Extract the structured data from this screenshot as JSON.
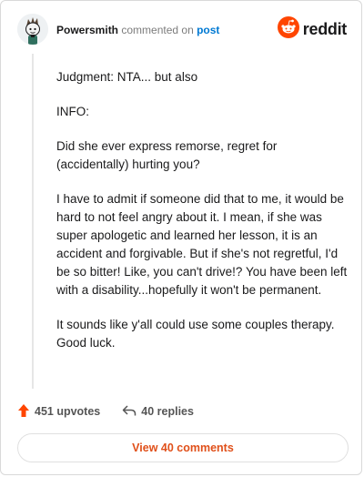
{
  "header": {
    "username": "Powersmith",
    "commented_text": "commented on",
    "post_link": "post",
    "brand": "reddit",
    "brand_color": "#ff4500"
  },
  "comment": {
    "paragraphs": [
      "Judgment: NTA... but also",
      "INFO:",
      "Did she ever express remorse, regret for (accidentally) hurting you?",
      "I have to admit if someone did that to me, it would be hard to not feel angry about it. I mean, if she was super apologetic and learned her lesson, it is an accident and forgivable. But if she's not regretful, I'd be so bitter! Like, you can't drive!? You have been left with a disability...hopefully it won't be permanent.",
      "It sounds like y'all could use some couples therapy. Good luck."
    ]
  },
  "actions": {
    "upvotes": "451 upvotes",
    "replies": "40 replies",
    "upvote_icon": "arrow-up-icon",
    "reply_icon": "reply-arrow-icon",
    "upvote_color": "#ff4500"
  },
  "footer": {
    "view_comments": "View 40 comments",
    "accent": "#e0501a"
  }
}
